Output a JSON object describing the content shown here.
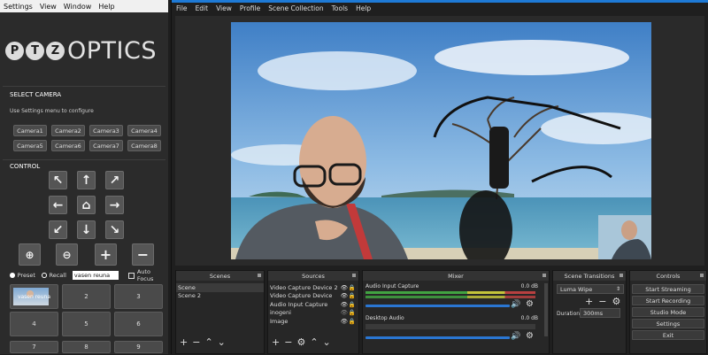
{
  "ptz_app": {
    "menu": [
      "Settings",
      "View",
      "Window",
      "Help"
    ],
    "logo": {
      "letters": [
        "P",
        "T",
        "Z"
      ],
      "brand": "OPTICS"
    },
    "select_camera_title": "SELECT CAMERA",
    "settings_hint": "Use Settings menu to configure",
    "cameras": [
      "Camera1",
      "Camera2",
      "Camera3",
      "Camera4",
      "Camera5",
      "Camera6",
      "Camera7",
      "Camera8"
    ],
    "control_title": "CONTROL",
    "preset_label": "Preset",
    "recall_label": "Recall",
    "recall_value": "vasen reuna",
    "auto_focus_label": "Auto Focus",
    "preset_grid": [
      "vasen reuna",
      "2",
      "3",
      "4",
      "5",
      "6",
      "7",
      "8",
      "9"
    ]
  },
  "obs": {
    "menu": [
      "File",
      "Edit",
      "View",
      "Profile",
      "Scene Collection",
      "Tools",
      "Help"
    ],
    "scenes": {
      "title": "Scenes",
      "items": [
        "Scene",
        "Scene 2"
      ]
    },
    "sources": {
      "title": "Sources",
      "items": [
        "Video Capture Device 2",
        "Video Capture Device",
        "Audio Input Capture",
        "inogeni",
        "Image"
      ]
    },
    "mixer": {
      "title": "Mixer",
      "channels": [
        {
          "name": "Audio Input Capture",
          "db": "0.0 dB",
          "volume": 0.93
        },
        {
          "name": "Desktop Audio",
          "db": "0.0 dB",
          "volume": 0.93
        }
      ]
    },
    "transitions": {
      "title": "Scene Transitions",
      "selected": "Luma Wipe",
      "duration_label": "Duration",
      "duration_value": "300ms"
    },
    "controls": {
      "title": "Controls",
      "buttons": [
        "Start Streaming",
        "Start Recording",
        "Studio Mode",
        "Settings",
        "Exit"
      ]
    }
  },
  "colors": {
    "accent_blue": "#1e7ad6",
    "panel_bg": "#272727",
    "ptz_bg": "#2b2b2b"
  }
}
